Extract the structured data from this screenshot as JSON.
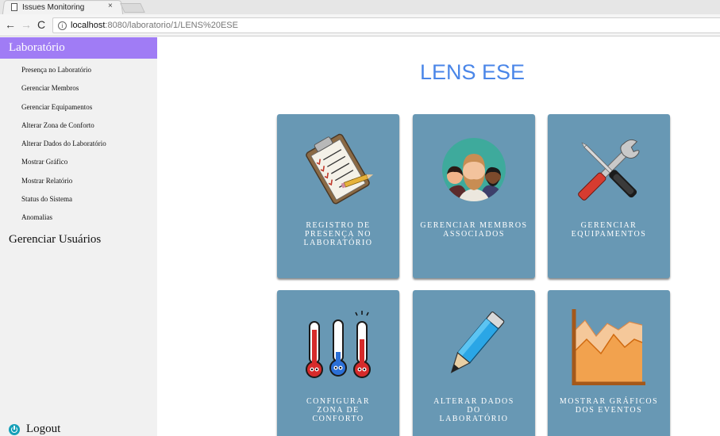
{
  "browser": {
    "tab_title": "Issues Monitoring",
    "tab_close": "×",
    "url_host": "localhost",
    "url_rest": ":8080/laboratorio/1/LENS%20ESE"
  },
  "sidebar": {
    "header": "Laboratório",
    "items": [
      {
        "label": "Presença no Laboratório"
      },
      {
        "label": "Gerenciar Membros"
      },
      {
        "label": "Gerenciar Equipamentos"
      },
      {
        "label": "Alterar Zona de Conforto"
      },
      {
        "label": "Alterar Dados do Laboratório"
      },
      {
        "label": "Mostrar Gráfico"
      },
      {
        "label": "Mostrar Relatório"
      },
      {
        "label": "Status do Sistema"
      },
      {
        "label": "Anomalias"
      }
    ],
    "users": "Gerenciar Usuários",
    "logout": "Logout"
  },
  "main": {
    "title": "LENS ESE",
    "cards": [
      {
        "label": "REGISTRO DE PRESENÇA NO LABORATÓRIO",
        "icon": "clipboard-icon"
      },
      {
        "label": "GERENCIAR MEMBROS ASSOCIADOS",
        "icon": "members-icon"
      },
      {
        "label": "GERENCIAR EQUIPAMENTOS",
        "icon": "tools-icon"
      },
      {
        "label": "CONFIGURAR ZONA DE CONFORTO",
        "icon": "thermometers-icon"
      },
      {
        "label": "ALTERAR DADOS DO LABORATÓRIO",
        "icon": "pencil-icon"
      },
      {
        "label": "MOSTRAR GRÁFICOS DOS EVENTOS",
        "icon": "area-chart-icon"
      }
    ]
  },
  "colors": {
    "sidebar_accent": "#a07cf5",
    "card_bg": "#6898b4",
    "title": "#4a86e8",
    "logout_icon": "#16a0b8"
  }
}
